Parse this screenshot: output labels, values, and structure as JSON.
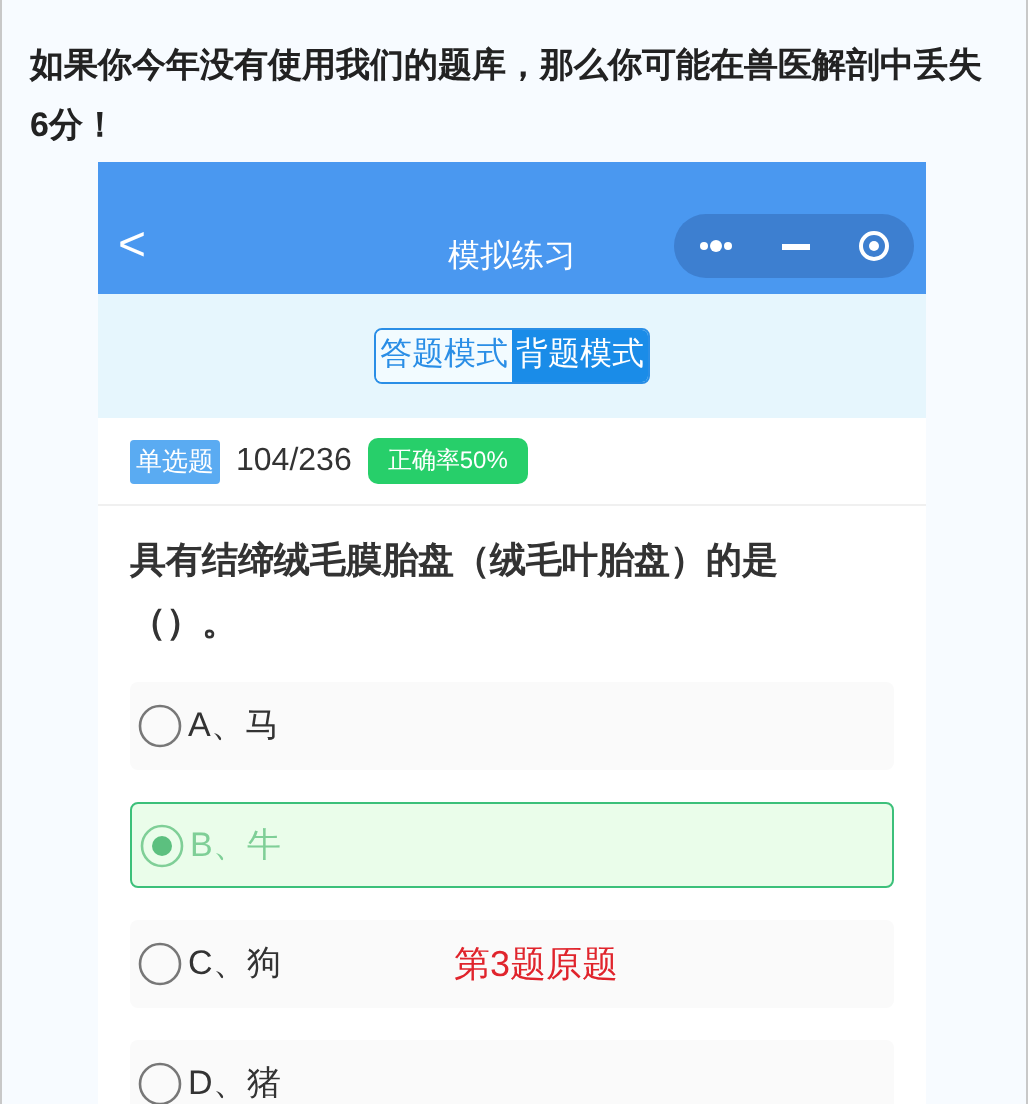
{
  "headline": "如果你今年没有使用我们的题库，那么你可能在兽医解剖中丢失6分！",
  "app": {
    "title": "模拟练习",
    "back": "<"
  },
  "modes": [
    {
      "label": "答题模式",
      "selected": false
    },
    {
      "label": "背题模式",
      "selected": true
    }
  ],
  "info": {
    "type": "单选题",
    "progress": "104/236",
    "accuracy": "正确率50%"
  },
  "question": "具有结缔绒毛膜胎盘（绒毛叶胎盘）的是（）。",
  "options": [
    {
      "label": "A、马",
      "selected": false
    },
    {
      "label": "B、牛",
      "selected": true
    },
    {
      "label": "C、狗",
      "selected": false,
      "note": "第3题原题"
    },
    {
      "label": "D、猪",
      "selected": false
    }
  ]
}
